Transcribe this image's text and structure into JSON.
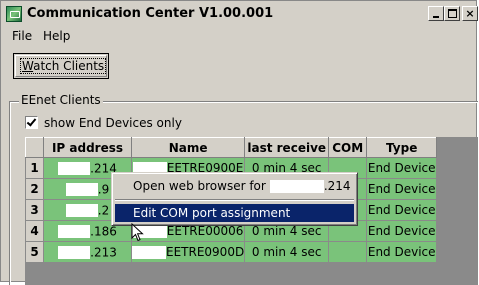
{
  "window": {
    "title": "Communication Center V1.00.001",
    "close_glyph": "×"
  },
  "menu": {
    "file": "File",
    "help": "Help"
  },
  "toolbar": {
    "watch_clients_prefix": "W",
    "watch_clients_rest": "atch Clients"
  },
  "group": {
    "label": "EEnet Clients"
  },
  "filter": {
    "show_end_devices_label": "show End Devices only",
    "checked": true
  },
  "grid": {
    "columns": [
      "IP address",
      "Name",
      "last receive",
      "COM",
      "Type"
    ],
    "rows": [
      {
        "num": "1",
        "ip_suffix": ".214",
        "name": "EETRE0900E",
        "last_receive": "0 min 4 sec",
        "com": "",
        "type": "End Device"
      },
      {
        "num": "2",
        "ip_suffix": ".9",
        "name": "",
        "last_receive": "",
        "com": "",
        "type": "End Device"
      },
      {
        "num": "3",
        "ip_suffix": ".2",
        "name": "",
        "last_receive": "",
        "com": "",
        "type": "End Device"
      },
      {
        "num": "4",
        "ip_suffix": ".186",
        "name": "EETRE00006",
        "last_receive": "0 min 4 sec",
        "com": "",
        "type": "End Device"
      },
      {
        "num": "5",
        "ip_suffix": ".213",
        "name": "EETRE0900D",
        "last_receive": "0 min 4 sec",
        "com": "",
        "type": "End Device"
      }
    ]
  },
  "context_menu": {
    "open_browser_prefix": "Open web browser for",
    "open_browser_suffix": ".214",
    "edit_com": "Edit COM port assignment"
  },
  "colors": {
    "cell_green": "#7ac37a",
    "menu_highlight": "#0a246a",
    "window_face": "#d4d0c8"
  }
}
